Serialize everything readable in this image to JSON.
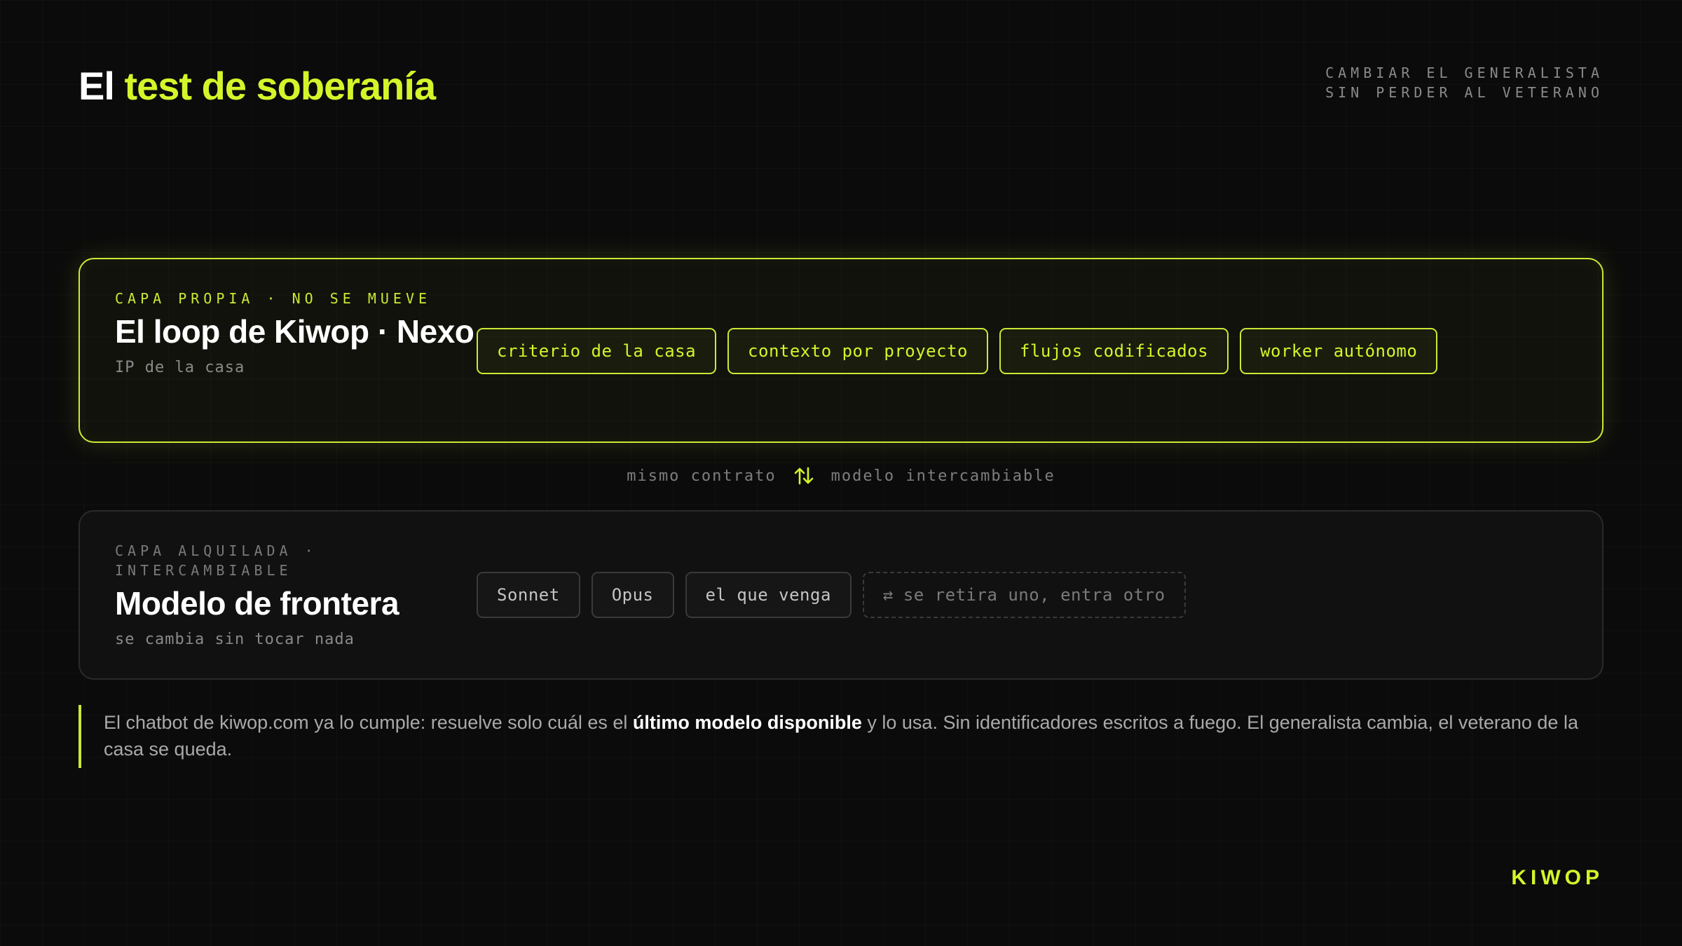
{
  "header": {
    "title_prefix": "El",
    "title_accent": "test de soberanía",
    "kicker_line1": "CAMBIAR EL GENERALISTA",
    "kicker_line2": "SIN PERDER AL VETERANO"
  },
  "own_layer": {
    "label": "CAPA PROPIA · NO SE MUEVE",
    "title": "El loop de Kiwop · Nexo",
    "subtitle": "IP de la casa",
    "chips": [
      "criterio de la casa",
      "contexto por proyecto",
      "flujos codificados",
      "worker autónomo"
    ]
  },
  "connector": {
    "left": "mismo contrato",
    "right": "modelo intercambiable",
    "icon": "swap-vertical-arrows-icon"
  },
  "rented_layer": {
    "label": "CAPA ALQUILADA · INTERCAMBIABLE",
    "title": "Modelo de frontera",
    "subtitle": "se cambia sin tocar nada",
    "chips": [
      "Sonnet",
      "Opus",
      "el que venga"
    ],
    "placeholder_chip": "se retira uno, entra otro",
    "placeholder_icon": "swap-horizontal-icon"
  },
  "note": {
    "text_before": "El chatbot de kiwop.com ya lo cumple: resuelve solo cuál es el ",
    "text_bold": "último modelo disponible",
    "text_after": " y lo usa. Sin identificadores escritos a fuego. El generalista cambia, el veterano de la casa se queda."
  },
  "brand": "KIWOP",
  "colors": {
    "accent": "#d4f52a",
    "background": "#0b0b0b",
    "muted_text": "#8a8a8a"
  }
}
